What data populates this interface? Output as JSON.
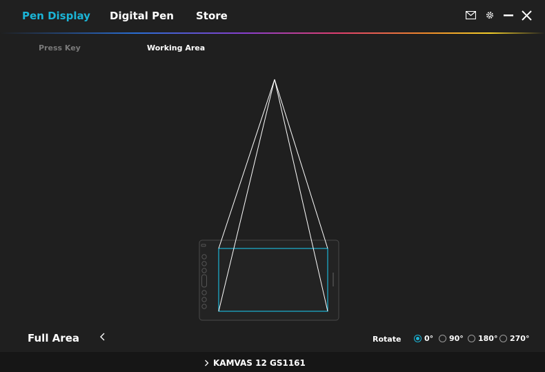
{
  "nav": {
    "tabs": [
      {
        "label": "Pen Display"
      },
      {
        "label": "Digital Pen"
      },
      {
        "label": "Store"
      }
    ]
  },
  "subtabs": {
    "press_key": "Press Key",
    "working_area": "Working Area"
  },
  "icons": {
    "mail": "mail-icon",
    "settings": "gear-icon",
    "minimize": "minimize-icon",
    "close": "close-icon"
  },
  "area": {
    "mode_label": "Full Area"
  },
  "rotate": {
    "label": "Rotate",
    "options": [
      {
        "label": "0°",
        "selected": true
      },
      {
        "label": "90°",
        "selected": false
      },
      {
        "label": "180°",
        "selected": false
      },
      {
        "label": "270°",
        "selected": false
      }
    ]
  },
  "device": {
    "name": "KAMVAS 12 GS1161"
  },
  "colors": {
    "accent": "#1bb4d6",
    "background": "#1f1f1f"
  }
}
